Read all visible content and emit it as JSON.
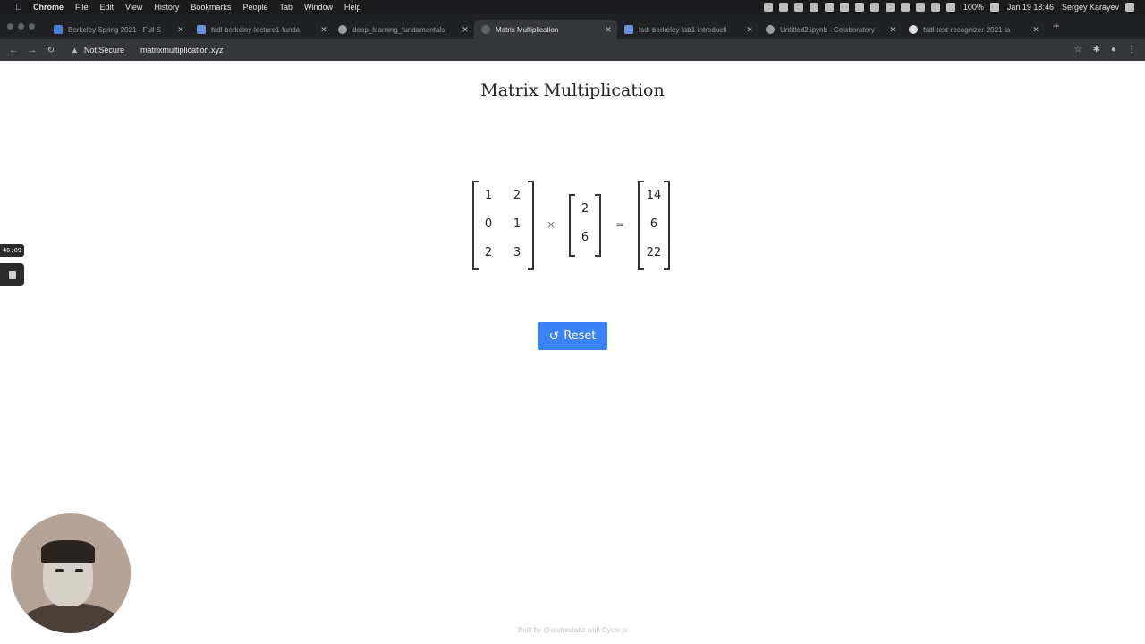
{
  "menubar": {
    "app_name": "Chrome",
    "items": [
      "File",
      "Edit",
      "View",
      "History",
      "Bookmarks",
      "People",
      "Tab",
      "Window",
      "Help"
    ],
    "battery": "100%",
    "clock": "Jan 19  18:46",
    "user": "Sergey Karayev"
  },
  "tabs": [
    {
      "title": "Berkeley Spring 2021 - Full S",
      "favicon_color": "#4a7dd6",
      "active": false
    },
    {
      "title": "fsdl-berkeley-lecture1-funda",
      "favicon_color": "#6b8fd6",
      "active": false
    },
    {
      "title": "deep_learning_fundamentals",
      "favicon_color": "#9aa0a6",
      "active": false
    },
    {
      "title": "Matrix Multiplication",
      "favicon_color": "#5f6368",
      "active": true
    },
    {
      "title": "fsdl-berkeley-lab1-introducti",
      "favicon_color": "#6b8fd6",
      "active": false
    },
    {
      "title": "Untitled2.ipynb - Colaboratory",
      "favicon_color": "#9aa0a6",
      "active": false
    },
    {
      "title": "fsdl-text-recognizer-2021-la",
      "favicon_color": "#e0e0e0",
      "active": false
    }
  ],
  "addressbar": {
    "security_label": "Not Secure",
    "url": "matrixmultiplication.xyz"
  },
  "page": {
    "title": "Matrix Multiplication",
    "matrix_a": [
      [
        "1",
        "2"
      ],
      [
        "0",
        "1"
      ],
      [
        "2",
        "3"
      ]
    ],
    "vector_b": [
      [
        "2"
      ],
      [
        "6"
      ]
    ],
    "result": [
      [
        "14"
      ],
      [
        "6"
      ],
      [
        "22"
      ]
    ],
    "times_symbol": "×",
    "equals_symbol": "=",
    "reset_label": "Reset",
    "footer": "Built by @andrestaltz with Cycle.js"
  },
  "overlay": {
    "timer": "46:09"
  },
  "colors": {
    "accent": "#3b82f6",
    "chrome_dark": "#202124"
  }
}
